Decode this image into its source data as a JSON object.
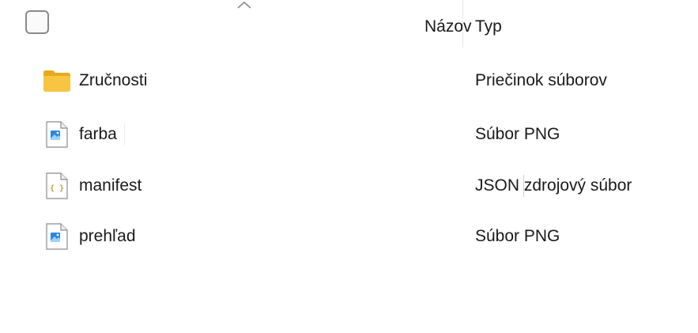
{
  "header": {
    "columns": {
      "name_label": "Názov",
      "type_label": "Typ"
    },
    "sort_icon": "chevron-up-icon",
    "select_all_icon": "checkbox-icon"
  },
  "rows": [
    {
      "name": "Zručnosti",
      "type": "Priečinok súborov",
      "icon": "folder-icon"
    },
    {
      "name": "farba",
      "type": "Súbor PNG",
      "icon": "image-file-icon"
    },
    {
      "name": "manifest",
      "type": "JSON zdrojový súbor",
      "icon": "json-file-icon"
    },
    {
      "name": "prehľad",
      "type": "Súbor PNG",
      "icon": "image-file-icon"
    }
  ],
  "colors": {
    "folder_yellow": "#F8C542",
    "folder_dark": "#E8A91C",
    "image_blue": "#2E86DE",
    "json_braces": "#B5A33A"
  }
}
